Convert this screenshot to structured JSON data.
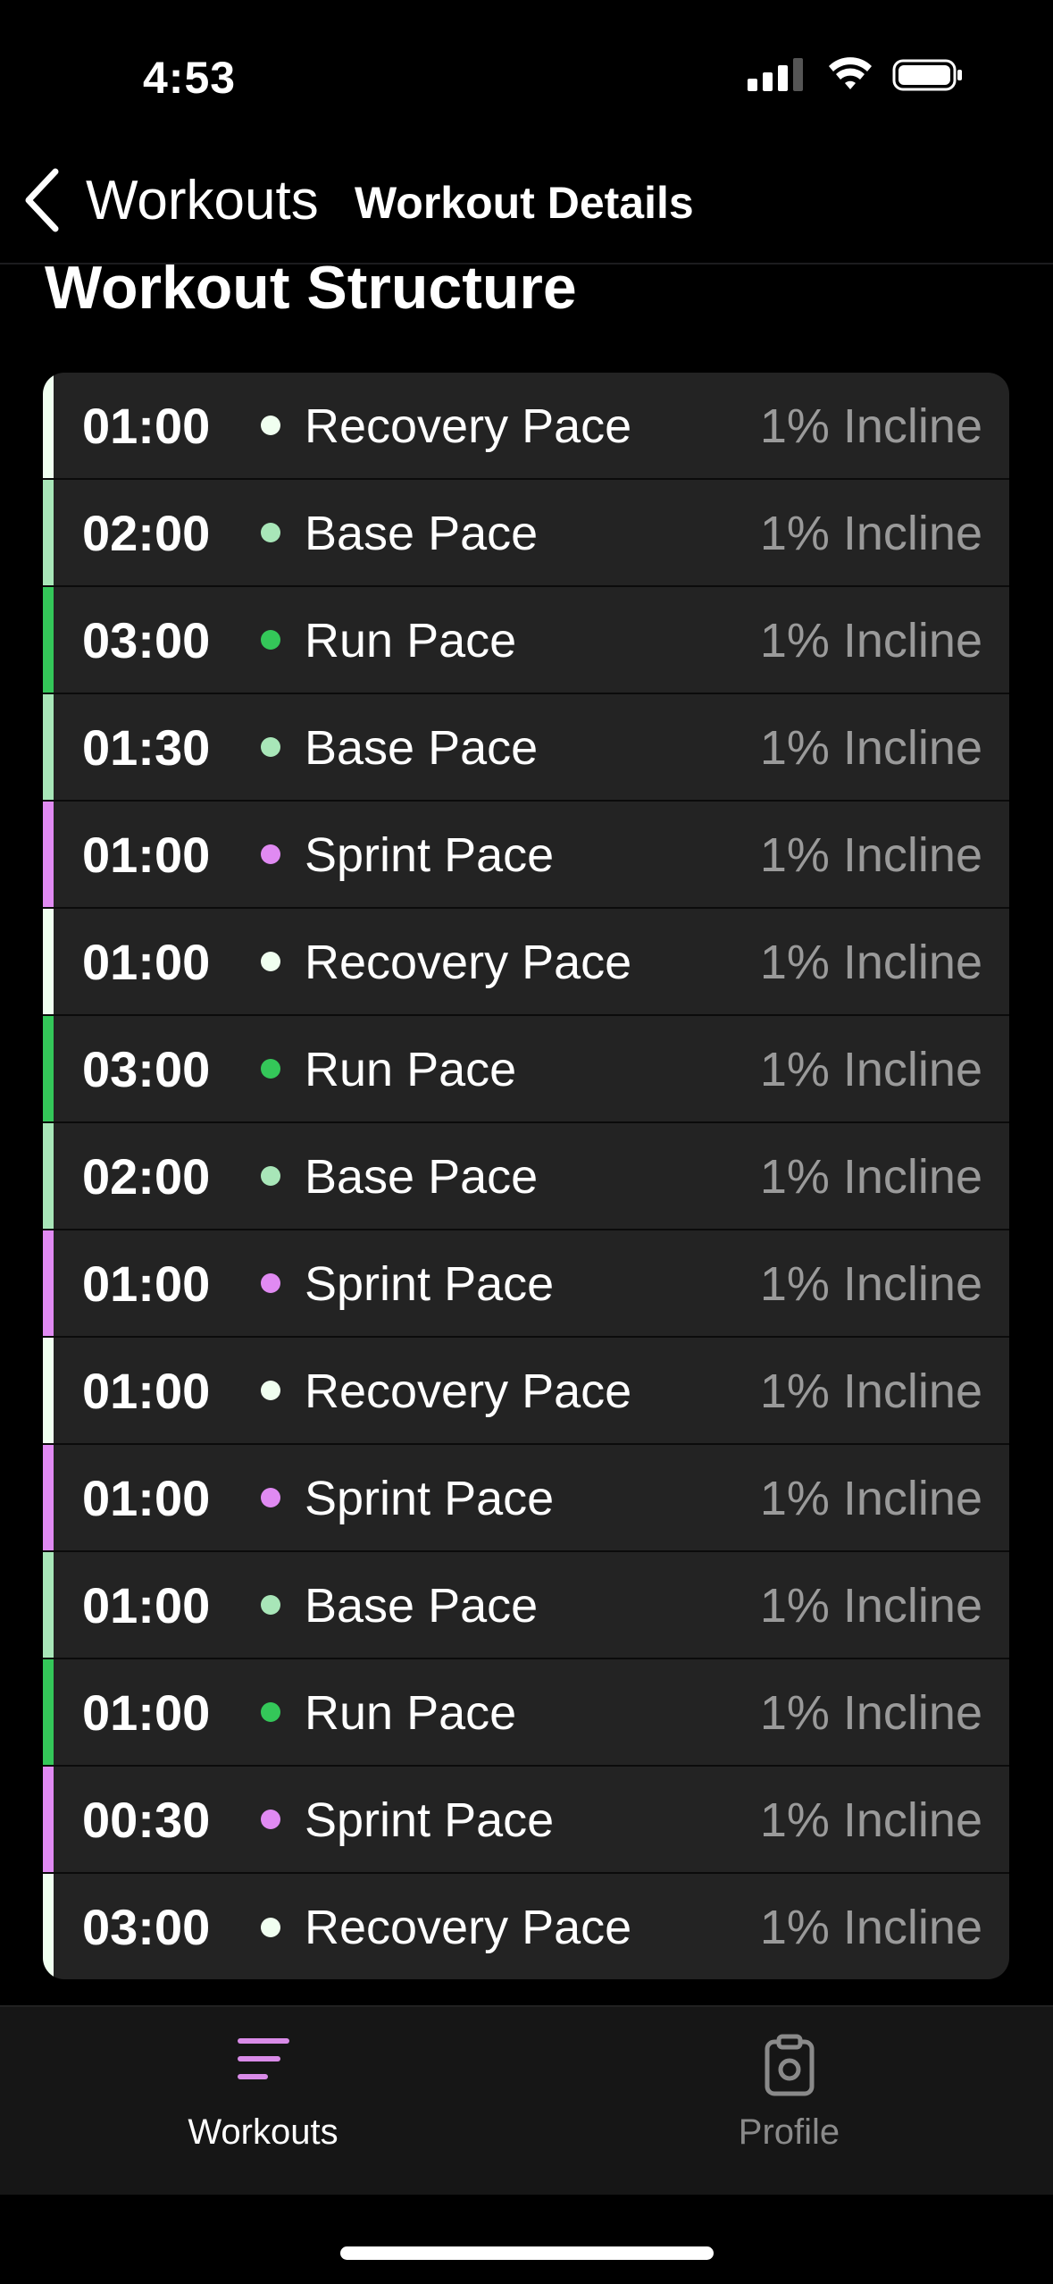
{
  "status": {
    "time": "4:53"
  },
  "nav": {
    "back_label": "Workouts",
    "title": "Workout Details"
  },
  "section": {
    "title": "Workout Structure"
  },
  "colors": {
    "recovery": "#f0fff0",
    "base": "#a8e6b8",
    "run": "#34c759",
    "sprint": "#e08af2",
    "tab_active_icon": "#d98be8",
    "tab_inactive": "#8a8a8a"
  },
  "intervals": [
    {
      "time": "01:00",
      "pace": "Recovery Pace",
      "incline": "1% Incline",
      "type": "recovery"
    },
    {
      "time": "02:00",
      "pace": "Base Pace",
      "incline": "1% Incline",
      "type": "base"
    },
    {
      "time": "03:00",
      "pace": "Run Pace",
      "incline": "1% Incline",
      "type": "run"
    },
    {
      "time": "01:30",
      "pace": "Base Pace",
      "incline": "1% Incline",
      "type": "base"
    },
    {
      "time": "01:00",
      "pace": "Sprint Pace",
      "incline": "1% Incline",
      "type": "sprint"
    },
    {
      "time": "01:00",
      "pace": "Recovery Pace",
      "incline": "1% Incline",
      "type": "recovery"
    },
    {
      "time": "03:00",
      "pace": "Run Pace",
      "incline": "1% Incline",
      "type": "run"
    },
    {
      "time": "02:00",
      "pace": "Base Pace",
      "incline": "1% Incline",
      "type": "base"
    },
    {
      "time": "01:00",
      "pace": "Sprint Pace",
      "incline": "1% Incline",
      "type": "sprint"
    },
    {
      "time": "01:00",
      "pace": "Recovery Pace",
      "incline": "1% Incline",
      "type": "recovery"
    },
    {
      "time": "01:00",
      "pace": "Sprint Pace",
      "incline": "1% Incline",
      "type": "sprint"
    },
    {
      "time": "01:00",
      "pace": "Base Pace",
      "incline": "1% Incline",
      "type": "base"
    },
    {
      "time": "01:00",
      "pace": "Run Pace",
      "incline": "1% Incline",
      "type": "run"
    },
    {
      "time": "00:30",
      "pace": "Sprint Pace",
      "incline": "1% Incline",
      "type": "sprint"
    },
    {
      "time": "03:00",
      "pace": "Recovery Pace",
      "incline": "1% Incline",
      "type": "recovery"
    }
  ],
  "tabs": [
    {
      "label": "Workouts",
      "icon": "list-lines-icon",
      "active": true
    },
    {
      "label": "Profile",
      "icon": "clipboard-icon",
      "active": false
    }
  ]
}
